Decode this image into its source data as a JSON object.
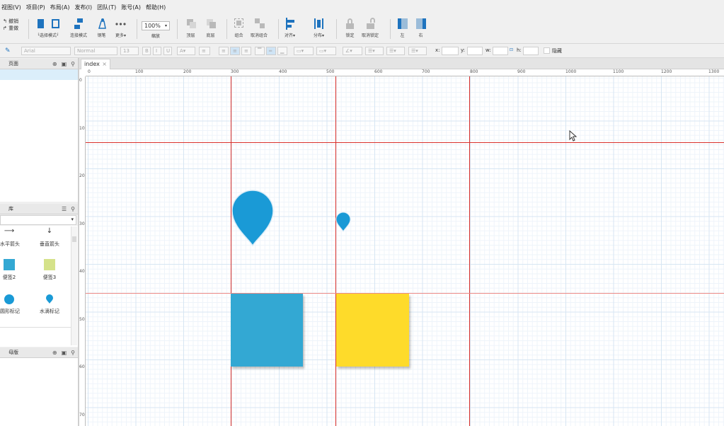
{
  "menu": [
    "视图(V)",
    "项目(P)",
    "布局(A)",
    "发布(I)",
    "团队(T)",
    "账号(A)",
    "帮助(H)"
  ],
  "toolbar": {
    "undo": "撤销",
    "redo": "重做",
    "select_mode": "└选择模式┘",
    "connect_mode": "连接模式",
    "pen": "钢笔",
    "more": "更多▾",
    "zoom": "100%",
    "zoom_label": "缩放",
    "top": "顶层",
    "bottom": "底层",
    "group": "组合",
    "ungroup": "取消组合",
    "align": "对齐▾",
    "distribute": "分布▾",
    "lock": "锁定",
    "unlock": "取消锁定",
    "left": "左",
    "right": "右"
  },
  "formatbar": {
    "font": "Arial",
    "style": "Normal",
    "size": "13",
    "x_label": "x:",
    "y_label": "y:",
    "w_label": "w:",
    "h_label": "h:",
    "hidden_label": "隐藏"
  },
  "panels": {
    "pages": "页面",
    "library": "库",
    "masters": "母版"
  },
  "library_items": [
    {
      "label": "水平箭头",
      "icon": "horizontal-arrow-icon"
    },
    {
      "label": "垂直箭头",
      "icon": "vertical-arrow-icon"
    },
    {
      "label": "便签2",
      "icon": "sticky-blue-icon"
    },
    {
      "label": "便签3",
      "icon": "sticky-green-icon"
    },
    {
      "label": "圆形标记",
      "icon": "circle-marker-icon"
    },
    {
      "label": "水滴标记",
      "icon": "drop-marker-icon"
    }
  ],
  "tabs": [
    {
      "label": "index",
      "close": "×"
    }
  ],
  "ruler_top": [
    "0",
    "100",
    "200",
    "300",
    "400",
    "500",
    "600",
    "700",
    "800",
    "900",
    "1000",
    "1100",
    "1200",
    "1300"
  ],
  "ruler_left": [
    "0",
    "100",
    "200",
    "300",
    "400",
    "500",
    "600",
    "700"
  ],
  "colors": {
    "accent": "#1e73be",
    "drop_marker": "#1a9ad6",
    "sticky_blue": "#33a8d3",
    "sticky_yellow": "#fedb2a",
    "guide": "#d9302c"
  }
}
